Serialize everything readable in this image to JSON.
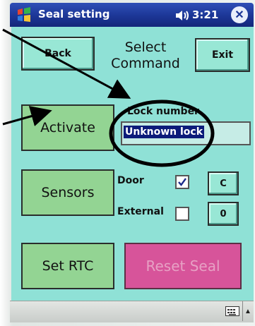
{
  "titlebar": {
    "title": "Seal setting",
    "time": "3:21",
    "close_symbol": "✕",
    "icons": [
      "windows-start-icon",
      "speaker-icon",
      "close-icon"
    ]
  },
  "header": {
    "back_label": "Back",
    "select_command_line1": "Select",
    "select_command_line2": "Command",
    "exit_label": "Exit"
  },
  "actions": {
    "activate_label": "Activate",
    "sensors_label": "Sensors",
    "set_rtc_label": "Set RTC",
    "reset_seal_label": "Reset Seal"
  },
  "lock": {
    "label": "Lock number",
    "value": "Unknown lock"
  },
  "sensors": {
    "door_label": "Door",
    "door_checked": true,
    "door_button": "C",
    "external_label": "External",
    "external_checked": false,
    "external_button": "0"
  },
  "bottombar": {
    "sip_arrow": "▲"
  },
  "colors": {
    "titlebar": "#1c3696",
    "content_bg": "#8fe1d6",
    "green_button": "#93d493",
    "pink_button": "#d7549a"
  }
}
